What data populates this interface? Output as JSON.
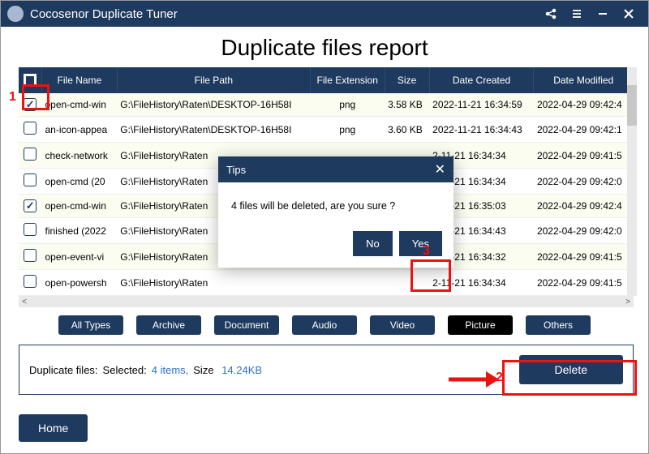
{
  "titlebar": {
    "app": "Cocosenor Duplicate Tuner"
  },
  "heading": "Duplicate files report",
  "columns": {
    "name": "File Name",
    "path": "File Path",
    "ext": "File Extension",
    "size": "Size",
    "created": "Date Created",
    "modified": "Date Modified"
  },
  "rows": [
    {
      "checked": true,
      "name": "open-cmd-win",
      "path": "G:\\FileHistory\\Raten\\DESKTOP-16H58I",
      "ext": "png",
      "size": "3.58 KB",
      "created": "2022-11-21 16:34:59",
      "modified": "2022-04-29 09:42:4"
    },
    {
      "checked": false,
      "name": "an-icon-appea",
      "path": "G:\\FileHistory\\Raten\\DESKTOP-16H58I",
      "ext": "png",
      "size": "3.60 KB",
      "created": "2022-11-21 16:34:43",
      "modified": "2022-04-29 09:42:1"
    },
    {
      "checked": false,
      "name": "check-network",
      "path": "G:\\FileHistory\\Raten",
      "ext": "",
      "size": "",
      "created": "2-11-21 16:34:34",
      "modified": "2022-04-29 09:41:5"
    },
    {
      "checked": false,
      "name": "open-cmd (20",
      "path": "G:\\FileHistory\\Raten",
      "ext": "",
      "size": "",
      "created": "2-11-21 16:34:34",
      "modified": "2022-04-29 09:42:0"
    },
    {
      "checked": true,
      "name": "open-cmd-win",
      "path": "G:\\FileHistory\\Raten",
      "ext": "",
      "size": "",
      "created": "2-11-21 16:35:03",
      "modified": "2022-04-29 09:42:4"
    },
    {
      "checked": false,
      "name": "finished (2022",
      "path": "G:\\FileHistory\\Raten",
      "ext": "",
      "size": "",
      "created": "2-11-21 16:34:43",
      "modified": "2022-04-29 09:42:0"
    },
    {
      "checked": false,
      "name": "open-event-vi",
      "path": "G:\\FileHistory\\Raten",
      "ext": "",
      "size": "",
      "created": "2-11-21 16:34:32",
      "modified": "2022-04-29 09:41:5"
    },
    {
      "checked": false,
      "name": "open-powersh",
      "path": "G:\\FileHistory\\Raten",
      "ext": "",
      "size": "",
      "created": "2-11-21 16:34:34",
      "modified": "2022-04-29 09:41:5"
    }
  ],
  "filters": [
    {
      "label": "All Types",
      "active": false
    },
    {
      "label": "Archive",
      "active": false
    },
    {
      "label": "Document",
      "active": false
    },
    {
      "label": "Audio",
      "active": false
    },
    {
      "label": "Video",
      "active": false
    },
    {
      "label": "Picture",
      "active": true
    },
    {
      "label": "Others",
      "active": false
    }
  ],
  "summary": {
    "label": "Duplicate files:",
    "selected_label": "Selected:",
    "items": "4 items,",
    "size_label": "Size",
    "size": "14.24KB"
  },
  "buttons": {
    "delete": "Delete",
    "home": "Home"
  },
  "modal": {
    "title": "Tips",
    "message": "4 files will be deleted, are you sure ?",
    "no": "No",
    "yes": "Yes"
  },
  "annotations": {
    "a1": "1",
    "a2": "2",
    "a3": "3"
  }
}
